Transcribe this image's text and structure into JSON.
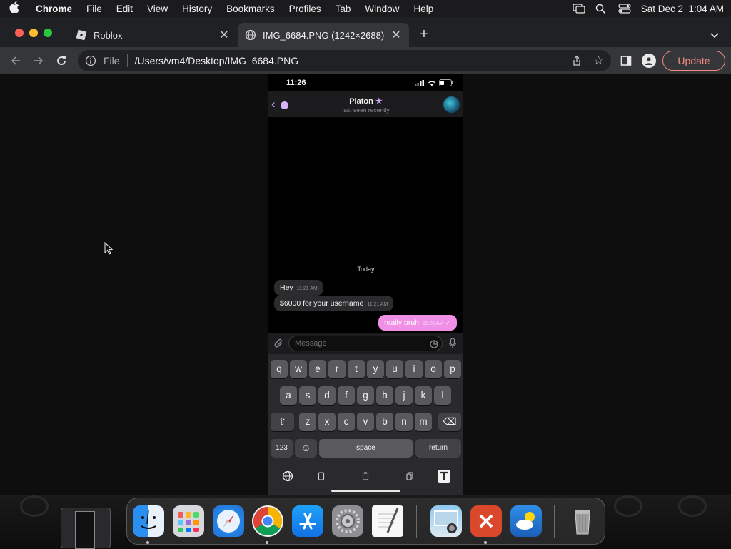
{
  "menubar": {
    "app": "Chrome",
    "items": [
      "File",
      "Edit",
      "View",
      "History",
      "Bookmarks",
      "Profiles",
      "Tab",
      "Window",
      "Help"
    ],
    "datetime": "Sat Dec 2  1:04 AM"
  },
  "tabs": [
    {
      "title": "Roblox",
      "active": false
    },
    {
      "title": "IMG_6684.PNG (1242×2688)",
      "active": true
    }
  ],
  "toolbar": {
    "scheme": "File",
    "url": "/Users/vm4/Desktop/IMG_6684.PNG",
    "update_label": "Update"
  },
  "phone": {
    "time": "11:26",
    "contact_name": "Platon",
    "contact_status": "last seen recently",
    "date_chip": "Today",
    "messages": [
      {
        "text": "Hey",
        "time": "11:21 AM",
        "outgoing": false
      },
      {
        "text": "$6000 for your username",
        "time": "11:21 AM",
        "outgoing": false
      },
      {
        "text": "really bruh",
        "time": "11:26 AM",
        "outgoing": true
      }
    ],
    "input_placeholder": "Message",
    "keyboard": {
      "row1": [
        "q",
        "w",
        "e",
        "r",
        "t",
        "y",
        "u",
        "i",
        "o",
        "p"
      ],
      "row2": [
        "a",
        "s",
        "d",
        "f",
        "g",
        "h",
        "j",
        "k",
        "l"
      ],
      "row3": [
        "z",
        "x",
        "c",
        "v",
        "b",
        "n",
        "m"
      ],
      "numbers_key": "123",
      "space_key": "space",
      "return_key": "return"
    }
  },
  "dock": {
    "apps": [
      "Finder",
      "Launchpad",
      "Safari",
      "Google Chrome",
      "App Store",
      "System Settings",
      "TextEdit",
      "Preview",
      "Microsoft Remote Desktop",
      "Weather",
      "Trash"
    ]
  },
  "colors": {
    "accent_purple": "#c79df0",
    "outgoing_bubble": "#ef8fe5",
    "update_red": "#f28b82"
  }
}
